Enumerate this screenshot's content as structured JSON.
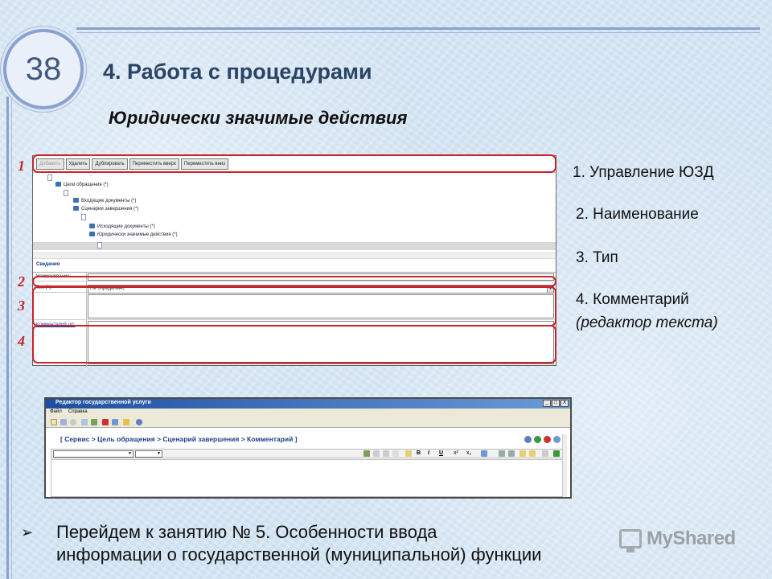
{
  "slide": {
    "number": "38",
    "title": "4. Работа с процедурами",
    "subtitle": "Юридически значимые действия"
  },
  "screenshot1": {
    "toolbar": [
      "Добавить",
      "Удалить",
      "Дублировать",
      "Переместить вверх",
      "Переместить вниз"
    ],
    "tree": {
      "goals": "Цели обращения (*)",
      "incoming_docs": "Входящие документы (*)",
      "completion_scenarios": "Сценарии завершения (*)",
      "outgoing_docs": "Исходящие документы (*)",
      "legal_actions": "Юридически значимые действия (*)"
    },
    "section_title": "Сведения",
    "fields": {
      "name_label": "Наименование:",
      "type_label": "Тип (*):",
      "type_value": "Не определено",
      "comment_label": "Комментарий (#):"
    },
    "markers": [
      "1",
      "2",
      "3",
      "4"
    ]
  },
  "legend": {
    "item1": "1. Управление ЮЗД",
    "item2": "2. Наименование",
    "item3": "3. Тип",
    "item4_line1": "4. Комментарий",
    "item4_line2": "(редактор текста)"
  },
  "screenshot2": {
    "window_title": "Редактор государственной услуги",
    "window_controls": [
      "_",
      "□",
      "X"
    ],
    "menu": [
      "Файл",
      "Справка"
    ],
    "breadcrumb": "[ Сервис > Цель обращения > Сценарий завершения > Комментарий ]",
    "format_buttons": [
      "B",
      "I",
      "U",
      "x²",
      "x₂"
    ]
  },
  "bottom": {
    "bullet": "➢",
    "line1": "Перейдем к занятию № 5. Особенности ввода",
    "line2": "информации о государственной (муниципальной) функции"
  },
  "watermark": "MyShared",
  "colors": {
    "highlight": "#c8242c",
    "title": "#2a4466",
    "frame": "#8aa0cf"
  }
}
